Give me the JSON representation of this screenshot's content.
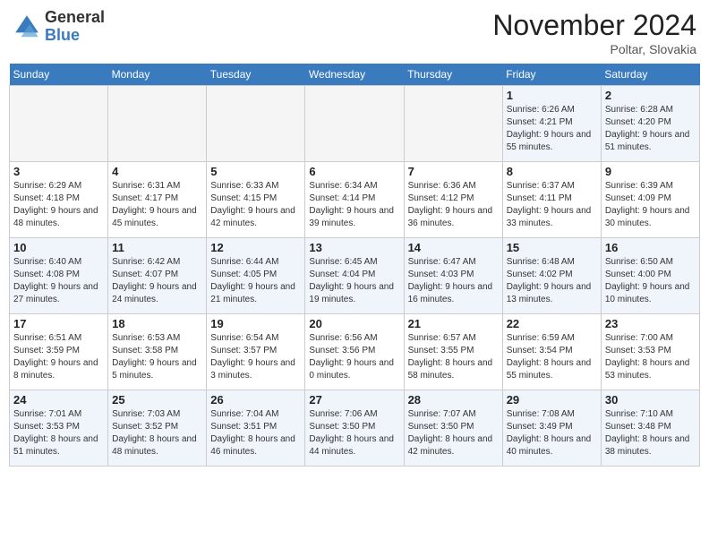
{
  "header": {
    "logo_general": "General",
    "logo_blue": "Blue",
    "title": "November 2024",
    "location": "Poltar, Slovakia"
  },
  "days_of_week": [
    "Sunday",
    "Monday",
    "Tuesday",
    "Wednesday",
    "Thursday",
    "Friday",
    "Saturday"
  ],
  "weeks": [
    [
      {
        "num": "",
        "info": ""
      },
      {
        "num": "",
        "info": ""
      },
      {
        "num": "",
        "info": ""
      },
      {
        "num": "",
        "info": ""
      },
      {
        "num": "",
        "info": ""
      },
      {
        "num": "1",
        "info": "Sunrise: 6:26 AM\nSunset: 4:21 PM\nDaylight: 9 hours and 55 minutes."
      },
      {
        "num": "2",
        "info": "Sunrise: 6:28 AM\nSunset: 4:20 PM\nDaylight: 9 hours and 51 minutes."
      }
    ],
    [
      {
        "num": "3",
        "info": "Sunrise: 6:29 AM\nSunset: 4:18 PM\nDaylight: 9 hours and 48 minutes."
      },
      {
        "num": "4",
        "info": "Sunrise: 6:31 AM\nSunset: 4:17 PM\nDaylight: 9 hours and 45 minutes."
      },
      {
        "num": "5",
        "info": "Sunrise: 6:33 AM\nSunset: 4:15 PM\nDaylight: 9 hours and 42 minutes."
      },
      {
        "num": "6",
        "info": "Sunrise: 6:34 AM\nSunset: 4:14 PM\nDaylight: 9 hours and 39 minutes."
      },
      {
        "num": "7",
        "info": "Sunrise: 6:36 AM\nSunset: 4:12 PM\nDaylight: 9 hours and 36 minutes."
      },
      {
        "num": "8",
        "info": "Sunrise: 6:37 AM\nSunset: 4:11 PM\nDaylight: 9 hours and 33 minutes."
      },
      {
        "num": "9",
        "info": "Sunrise: 6:39 AM\nSunset: 4:09 PM\nDaylight: 9 hours and 30 minutes."
      }
    ],
    [
      {
        "num": "10",
        "info": "Sunrise: 6:40 AM\nSunset: 4:08 PM\nDaylight: 9 hours and 27 minutes."
      },
      {
        "num": "11",
        "info": "Sunrise: 6:42 AM\nSunset: 4:07 PM\nDaylight: 9 hours and 24 minutes."
      },
      {
        "num": "12",
        "info": "Sunrise: 6:44 AM\nSunset: 4:05 PM\nDaylight: 9 hours and 21 minutes."
      },
      {
        "num": "13",
        "info": "Sunrise: 6:45 AM\nSunset: 4:04 PM\nDaylight: 9 hours and 19 minutes."
      },
      {
        "num": "14",
        "info": "Sunrise: 6:47 AM\nSunset: 4:03 PM\nDaylight: 9 hours and 16 minutes."
      },
      {
        "num": "15",
        "info": "Sunrise: 6:48 AM\nSunset: 4:02 PM\nDaylight: 9 hours and 13 minutes."
      },
      {
        "num": "16",
        "info": "Sunrise: 6:50 AM\nSunset: 4:00 PM\nDaylight: 9 hours and 10 minutes."
      }
    ],
    [
      {
        "num": "17",
        "info": "Sunrise: 6:51 AM\nSunset: 3:59 PM\nDaylight: 9 hours and 8 minutes."
      },
      {
        "num": "18",
        "info": "Sunrise: 6:53 AM\nSunset: 3:58 PM\nDaylight: 9 hours and 5 minutes."
      },
      {
        "num": "19",
        "info": "Sunrise: 6:54 AM\nSunset: 3:57 PM\nDaylight: 9 hours and 3 minutes."
      },
      {
        "num": "20",
        "info": "Sunrise: 6:56 AM\nSunset: 3:56 PM\nDaylight: 9 hours and 0 minutes."
      },
      {
        "num": "21",
        "info": "Sunrise: 6:57 AM\nSunset: 3:55 PM\nDaylight: 8 hours and 58 minutes."
      },
      {
        "num": "22",
        "info": "Sunrise: 6:59 AM\nSunset: 3:54 PM\nDaylight: 8 hours and 55 minutes."
      },
      {
        "num": "23",
        "info": "Sunrise: 7:00 AM\nSunset: 3:53 PM\nDaylight: 8 hours and 53 minutes."
      }
    ],
    [
      {
        "num": "24",
        "info": "Sunrise: 7:01 AM\nSunset: 3:53 PM\nDaylight: 8 hours and 51 minutes."
      },
      {
        "num": "25",
        "info": "Sunrise: 7:03 AM\nSunset: 3:52 PM\nDaylight: 8 hours and 48 minutes."
      },
      {
        "num": "26",
        "info": "Sunrise: 7:04 AM\nSunset: 3:51 PM\nDaylight: 8 hours and 46 minutes."
      },
      {
        "num": "27",
        "info": "Sunrise: 7:06 AM\nSunset: 3:50 PM\nDaylight: 8 hours and 44 minutes."
      },
      {
        "num": "28",
        "info": "Sunrise: 7:07 AM\nSunset: 3:50 PM\nDaylight: 8 hours and 42 minutes."
      },
      {
        "num": "29",
        "info": "Sunrise: 7:08 AM\nSunset: 3:49 PM\nDaylight: 8 hours and 40 minutes."
      },
      {
        "num": "30",
        "info": "Sunrise: 7:10 AM\nSunset: 3:48 PM\nDaylight: 8 hours and 38 minutes."
      }
    ]
  ]
}
